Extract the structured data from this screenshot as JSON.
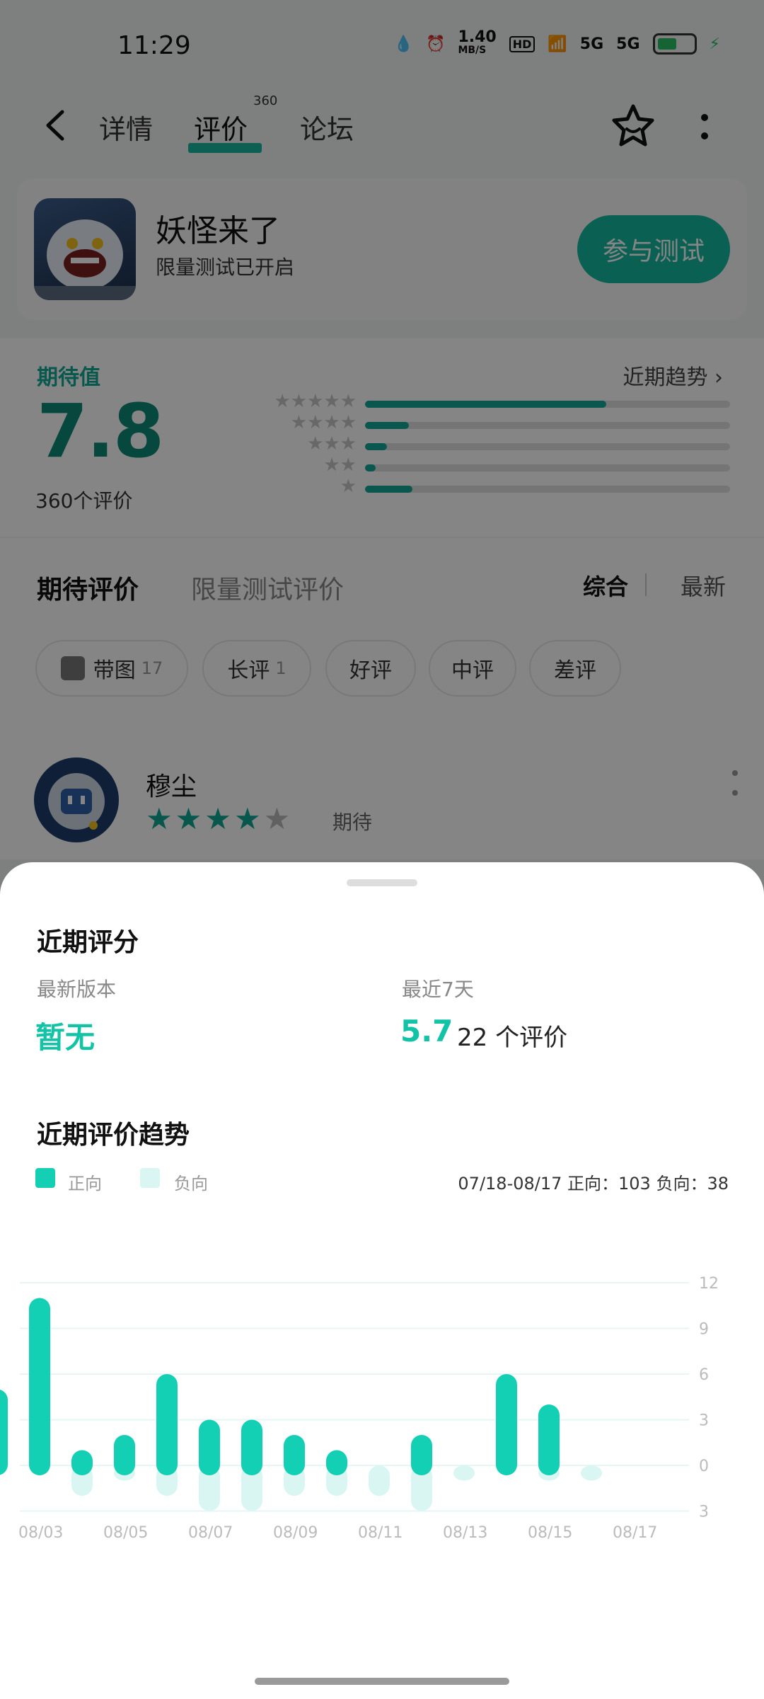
{
  "status": {
    "time": "11:29",
    "speed": "1.40",
    "speed_unit": "MB/S",
    "hd": "HD",
    "net1": "5G",
    "net2": "5G"
  },
  "nav": {
    "tabs": [
      "详情",
      "评价",
      "论坛"
    ],
    "active_tab": 1,
    "rating_badge": "360"
  },
  "app": {
    "name": "妖怪来了",
    "subtitle": "限量测试已开启",
    "join_label": "参与测试"
  },
  "rating": {
    "label": "期待值",
    "score": "7.8",
    "count_text": "360个评价",
    "trend_link": "近期趋势",
    "distribution": [
      {
        "stars": 5,
        "fraction": 0.66
      },
      {
        "stars": 4,
        "fraction": 0.12
      },
      {
        "stars": 3,
        "fraction": 0.06
      },
      {
        "stars": 2,
        "fraction": 0.03
      },
      {
        "stars": 1,
        "fraction": 0.13
      }
    ]
  },
  "reviews": {
    "tab_active": "期待评价",
    "tab_other": "限量测试评价",
    "sort_active": "综合",
    "sort_other": "最新",
    "chips": [
      {
        "label": "带图",
        "count": "17"
      },
      {
        "label": "长评",
        "count": "1"
      },
      {
        "label": "好评",
        "count": ""
      },
      {
        "label": "中评",
        "count": ""
      },
      {
        "label": "差评",
        "count": ""
      }
    ],
    "first": {
      "author": "穆尘",
      "stars": 4,
      "tag": "期待"
    }
  },
  "sheet": {
    "title": "近期评分",
    "latest_label": "最新版本",
    "latest_value": "暂无",
    "week_label": "最近7天",
    "week_score": "5.7",
    "week_count": "22 个评价",
    "trend_title": "近期评价趋势",
    "legend_positive": "正向",
    "legend_negative": "负向",
    "summary": "07/18-08/17  正向：103   负向：38",
    "colors": {
      "positive": "#13d0b4",
      "negative": "#d9f6f3",
      "grid": "#e7f6f4"
    }
  },
  "chart_data": {
    "type": "bar",
    "y_ticks": [
      "12",
      "9",
      "6",
      "3",
      "0",
      "3"
    ],
    "ylim": [
      -3,
      12
    ],
    "x_labels": [
      "08/03",
      "08/05",
      "08/07",
      "08/09",
      "08/11",
      "08/13",
      "08/15",
      "08/17"
    ],
    "series": [
      {
        "name": "正向",
        "values": [
          5,
          11,
          1,
          2,
          6,
          3,
          3,
          2,
          1,
          0,
          2,
          0,
          6,
          4,
          0
        ]
      },
      {
        "name": "负向",
        "values": [
          0,
          0,
          -2,
          -1,
          -2,
          -3,
          -3,
          -2,
          -2,
          -2,
          -3,
          -1,
          0,
          -1,
          -1
        ]
      }
    ],
    "categories": [
      "08/02",
      "08/03",
      "08/04",
      "08/05",
      "08/06",
      "08/07",
      "08/08",
      "08/09",
      "08/10",
      "08/11",
      "08/12",
      "08/13",
      "08/14",
      "08/15",
      "08/16"
    ]
  }
}
